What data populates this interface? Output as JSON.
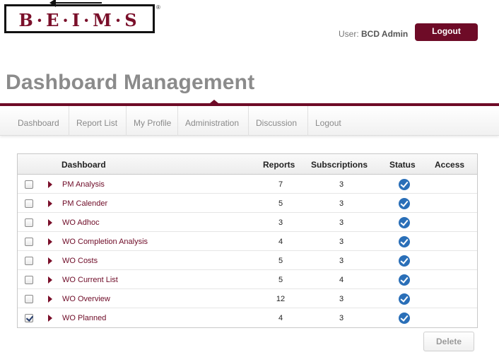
{
  "header": {
    "logo_text": "B·E·I·M·S",
    "logo_reg": "®",
    "user_label": "User:",
    "user_name": "BCD Admin",
    "logout_label": "Logout"
  },
  "page_title": "Dashboard Management",
  "nav": {
    "items": [
      {
        "label": "Dashboard"
      },
      {
        "label": "Report List"
      },
      {
        "label": "My Profile"
      },
      {
        "label": "Administration"
      },
      {
        "label": "Discussion"
      },
      {
        "label": "Logout"
      }
    ],
    "active": "Administration"
  },
  "table": {
    "headers": {
      "dashboard": "Dashboard",
      "reports": "Reports",
      "subscriptions": "Subscriptions",
      "status": "Status",
      "access": "Access"
    },
    "rows": [
      {
        "name": "PM Analysis",
        "reports": "7",
        "subscriptions": "3",
        "checked": false
      },
      {
        "name": "PM Calender",
        "reports": "5",
        "subscriptions": "3",
        "checked": false
      },
      {
        "name": "WO Adhoc",
        "reports": "3",
        "subscriptions": "3",
        "checked": false
      },
      {
        "name": "WO Completion Analysis",
        "reports": "4",
        "subscriptions": "3",
        "checked": false
      },
      {
        "name": "WO Costs",
        "reports": "5",
        "subscriptions": "3",
        "checked": false
      },
      {
        "name": "WO Current List",
        "reports": "5",
        "subscriptions": "4",
        "checked": false
      },
      {
        "name": "WO Overview",
        "reports": "12",
        "subscriptions": "3",
        "checked": false
      },
      {
        "name": "WO Planned",
        "reports": "4",
        "subscriptions": "3",
        "checked": true
      }
    ]
  },
  "delete_label": "Delete",
  "colors": {
    "brand": "#6e0b27",
    "status": "#2a6fb8",
    "title": "#8b8b8b"
  },
  "icons": {
    "row_expand": "triangle-right-icon",
    "status": "checkmark-circle-icon"
  }
}
